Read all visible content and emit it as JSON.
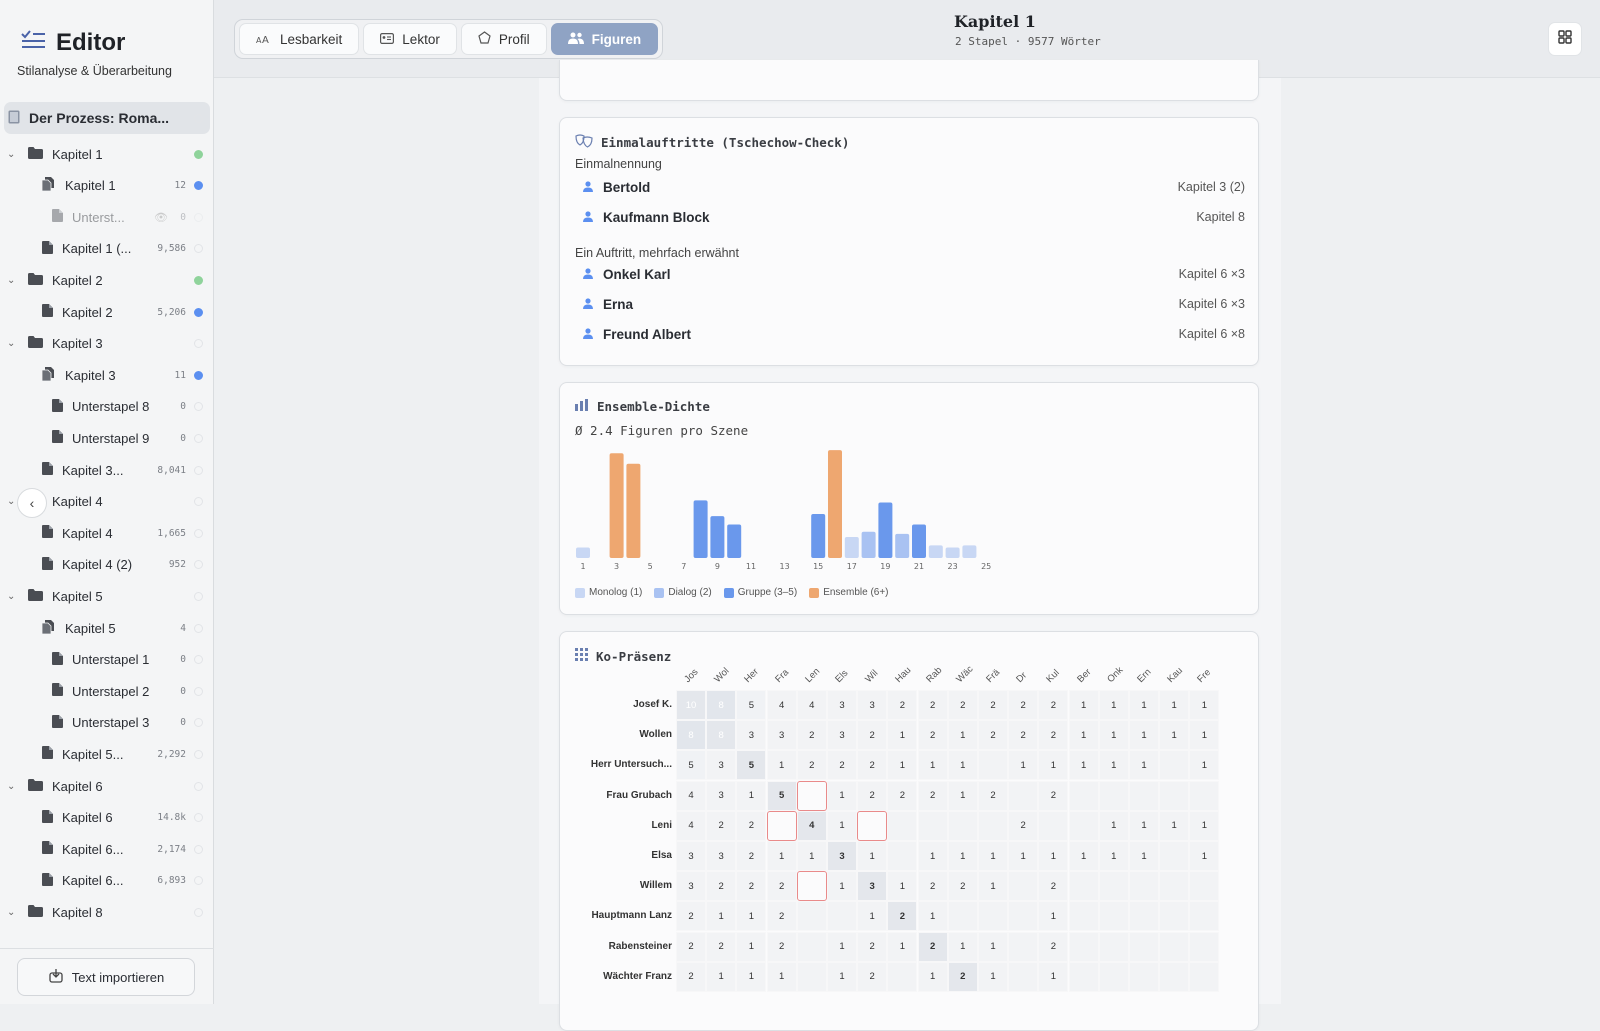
{
  "sidebar": {
    "title": "Editor",
    "subtitle": "Stilanalyse & Überarbeitung",
    "project": "Der Prozess: Roma...",
    "items": [
      {
        "label": "Kapitel 1",
        "type": "folder",
        "level": 0,
        "count": "",
        "dot": "green",
        "chevron": true
      },
      {
        "label": "Kapitel 1",
        "type": "stack",
        "level": 1,
        "count": "12",
        "dot": "blue"
      },
      {
        "label": "Unterst...",
        "type": "doc",
        "level": 2,
        "count": "0",
        "dot": "",
        "faded": true,
        "eye": true
      },
      {
        "label": "Kapitel 1 (...",
        "type": "doc",
        "level": 1,
        "count": "9,586",
        "dot": ""
      },
      {
        "label": "Kapitel 2",
        "type": "folder",
        "level": 0,
        "count": "",
        "dot": "green",
        "chevron": true
      },
      {
        "label": "Kapitel 2",
        "type": "doc",
        "level": 1,
        "count": "5,206",
        "dot": "blue"
      },
      {
        "label": "Kapitel 3",
        "type": "folder",
        "level": 0,
        "count": "",
        "dot": "",
        "chevron": true
      },
      {
        "label": "Kapitel 3",
        "type": "stack",
        "level": 1,
        "count": "11",
        "dot": "blue"
      },
      {
        "label": "Unterstapel 8",
        "type": "doc",
        "level": 2,
        "count": "0",
        "dot": ""
      },
      {
        "label": "Unterstapel 9",
        "type": "doc",
        "level": 2,
        "count": "0",
        "dot": ""
      },
      {
        "label": "Kapitel 3...",
        "type": "doc",
        "level": 1,
        "count": "8,041",
        "dot": ""
      },
      {
        "label": "Kapitel 4",
        "type": "folder",
        "level": 0,
        "count": "",
        "dot": "",
        "chevron": true
      },
      {
        "label": "Kapitel 4",
        "type": "doc",
        "level": 1,
        "count": "1,665",
        "dot": ""
      },
      {
        "label": "Kapitel 4 (2)",
        "type": "doc",
        "level": 1,
        "count": "952",
        "dot": ""
      },
      {
        "label": "Kapitel 5",
        "type": "folder",
        "level": 0,
        "count": "",
        "dot": "",
        "chevron": true
      },
      {
        "label": "Kapitel 5",
        "type": "stack",
        "level": 1,
        "count": "4",
        "dot": ""
      },
      {
        "label": "Unterstapel 1",
        "type": "doc",
        "level": 2,
        "count": "0",
        "dot": ""
      },
      {
        "label": "Unterstapel 2",
        "type": "doc",
        "level": 2,
        "count": "0",
        "dot": ""
      },
      {
        "label": "Unterstapel 3",
        "type": "doc",
        "level": 2,
        "count": "0",
        "dot": ""
      },
      {
        "label": "Kapitel 5...",
        "type": "doc",
        "level": 1,
        "count": "2,292",
        "dot": ""
      },
      {
        "label": "Kapitel 6",
        "type": "folder",
        "level": 0,
        "count": "",
        "dot": "",
        "chevron": true
      },
      {
        "label": "Kapitel 6",
        "type": "doc",
        "level": 1,
        "count": "14.8k",
        "dot": ""
      },
      {
        "label": "Kapitel 6...",
        "type": "doc",
        "level": 1,
        "count": "2,174",
        "dot": ""
      },
      {
        "label": "Kapitel 6...",
        "type": "doc",
        "level": 1,
        "count": "6,893",
        "dot": ""
      },
      {
        "label": "Kapitel 8",
        "type": "folder",
        "level": 0,
        "count": "",
        "dot": "",
        "chevron": true
      }
    ],
    "import_label": "Text importieren"
  },
  "toolbar": {
    "tabs": [
      {
        "label": "Lesbarkeit",
        "icon": "text-size-icon",
        "active": false
      },
      {
        "label": "Lektor",
        "icon": "id-card-icon",
        "active": false
      },
      {
        "label": "Profil",
        "icon": "pentagon-icon",
        "active": false
      },
      {
        "label": "Figuren",
        "icon": "people-icon",
        "active": true
      }
    ],
    "doc_title": "Kapitel 1",
    "doc_subtitle": "2 Stapel · 9577 Wörter"
  },
  "einmal": {
    "title": "Einmalauftritte (Tschechow-Check)",
    "section1": "Einmalnennung",
    "section2": "Ein Auftritt, mehrfach erwähnt",
    "rows1": [
      {
        "name": "Bertold",
        "where": "Kapitel 3 (2)"
      },
      {
        "name": "Kaufmann Block",
        "where": "Kapitel 8"
      }
    ],
    "rows2": [
      {
        "name": "Onkel Karl",
        "where": "Kapitel 6  ×3"
      },
      {
        "name": "Erna",
        "where": "Kapitel 6  ×3"
      },
      {
        "name": "Freund Albert",
        "where": "Kapitel 6  ×8"
      }
    ]
  },
  "ensemble": {
    "title": "Ensemble-Dichte",
    "subtitle": "Ø 2.4 Figuren pro Szene"
  },
  "chart_data": {
    "type": "bar",
    "title": "Ensemble-Dichte",
    "categories": [
      1,
      2,
      3,
      4,
      5,
      6,
      7,
      8,
      9,
      10,
      11,
      12,
      13,
      14,
      15,
      16,
      17,
      18,
      19,
      20,
      21,
      22,
      23,
      24,
      25
    ],
    "tick_labels": [
      "1",
      "3",
      "5",
      "7",
      "9",
      "11",
      "13",
      "15",
      "17",
      "19",
      "21",
      "23",
      "25"
    ],
    "values": [
      1,
      0,
      10,
      9,
      0,
      0,
      0,
      5.5,
      4,
      3.2,
      0,
      0,
      0,
      0,
      4.2,
      10.3,
      2,
      2.5,
      5.3,
      2.3,
      3.2,
      1.2,
      1,
      1.2,
      0
    ],
    "categories_type": [
      "Monolog",
      "",
      "Ensemble",
      "Ensemble",
      "",
      "",
      "",
      "Gruppe",
      "Gruppe",
      "Gruppe",
      "",
      "",
      "",
      "",
      "Gruppe",
      "Ensemble",
      "Monolog",
      "Dialog",
      "Gruppe",
      "Dialog",
      "Gruppe",
      "Monolog",
      "Monolog",
      "Monolog",
      ""
    ],
    "legend": [
      {
        "label": "Monolog (1)",
        "color": "#c8d7f4"
      },
      {
        "label": "Dialog (2)",
        "color": "#a9c2f2"
      },
      {
        "label": "Gruppe (3–5)",
        "color": "#6a98ec"
      },
      {
        "label": "Ensemble (6+)",
        "color": "#eea770"
      }
    ],
    "legend_position": "bottom-left",
    "grid": false
  },
  "kopraesenz": {
    "title": "Ko-Präsenz",
    "columns": [
      "Jos",
      "Wol",
      "Her",
      "Fra",
      "Len",
      "Els",
      "Wil",
      "Hau",
      "Rab",
      "Wäc",
      "Frä",
      "Dr",
      "Kul",
      "Ber",
      "Onk",
      "Ern",
      "Kau",
      "Fre"
    ],
    "rows": [
      {
        "label": "Josef K.",
        "cells": [
          "10",
          "8",
          "5",
          "4",
          "4",
          "3",
          "3",
          "2",
          "2",
          "2",
          "2",
          "2",
          "2",
          "1",
          "1",
          "1",
          "1",
          "1"
        ]
      },
      {
        "label": "Wollen",
        "cells": [
          "8",
          "8",
          "3",
          "3",
          "2",
          "3",
          "2",
          "1",
          "2",
          "1",
          "2",
          "2",
          "2",
          "1",
          "1",
          "1",
          "1",
          "1"
        ]
      },
      {
        "label": "Herr Untersuch...",
        "cells": [
          "5",
          "3",
          "5",
          "1",
          "2",
          "2",
          "2",
          "1",
          "1",
          "1",
          "",
          "1",
          "1",
          "1",
          "1",
          "1",
          "",
          "1"
        ]
      },
      {
        "label": "Frau Grubach",
        "cells": [
          "4",
          "3",
          "1",
          "5",
          "",
          "1",
          "2",
          "2",
          "2",
          "1",
          "2",
          "",
          "2",
          "",
          "",
          "",
          "",
          ""
        ]
      },
      {
        "label": "Leni",
        "cells": [
          "4",
          "2",
          "2",
          "",
          "4",
          "1",
          "",
          "",
          "",
          "",
          "",
          "2",
          "",
          "",
          "1",
          "1",
          "1",
          "1"
        ]
      },
      {
        "label": "Elsa",
        "cells": [
          "3",
          "3",
          "2",
          "1",
          "1",
          "3",
          "1",
          "",
          "1",
          "1",
          "1",
          "1",
          "1",
          "1",
          "1",
          "1",
          "",
          "1"
        ]
      },
      {
        "label": "Willem",
        "cells": [
          "3",
          "2",
          "2",
          "2",
          "",
          "1",
          "3",
          "1",
          "2",
          "2",
          "1",
          "",
          "2",
          "",
          "",
          "",
          "",
          ""
        ]
      },
      {
        "label": "Hauptmann Lanz",
        "cells": [
          "2",
          "1",
          "1",
          "2",
          "",
          "",
          "1",
          "2",
          "1",
          "",
          "",
          "",
          "1",
          "",
          "",
          "",
          "",
          ""
        ]
      },
      {
        "label": "Rabensteiner",
        "cells": [
          "2",
          "2",
          "1",
          "2",
          "",
          "1",
          "2",
          "1",
          "2",
          "1",
          "1",
          "",
          "2",
          "",
          "",
          "",
          "",
          ""
        ]
      },
      {
        "label": "Wächter Franz",
        "cells": [
          "2",
          "1",
          "1",
          "1",
          "",
          "1",
          "2",
          "",
          "1",
          "2",
          "1",
          "",
          "1",
          "",
          "",
          "",
          "",
          ""
        ]
      }
    ]
  }
}
